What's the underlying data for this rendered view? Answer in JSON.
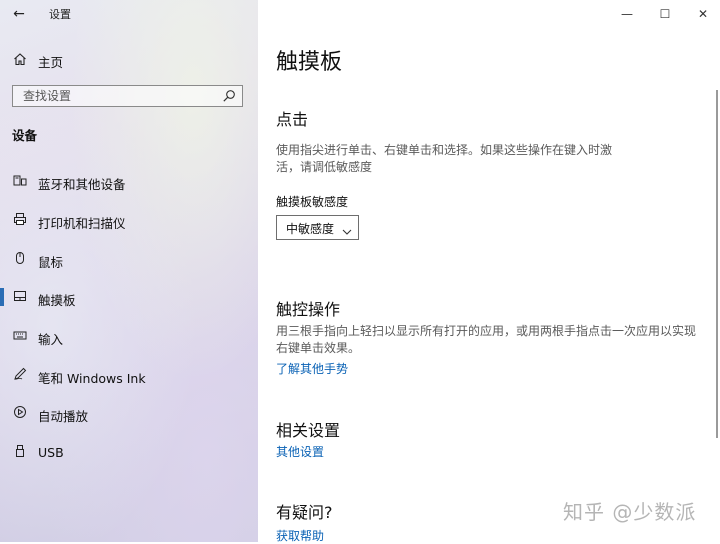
{
  "window": {
    "title": "设置",
    "back_glyph": "←",
    "minimize_glyph": "—",
    "maximize_glyph": "☐",
    "close_glyph": "✕"
  },
  "sidebar": {
    "home_label": "主页",
    "search_placeholder": "查找设置",
    "section_title": "设备",
    "items": [
      {
        "label": "蓝牙和其他设备",
        "icon": "bluetooth-devices-icon"
      },
      {
        "label": "打印机和扫描仪",
        "icon": "printer-icon"
      },
      {
        "label": "鼠标",
        "icon": "mouse-icon"
      },
      {
        "label": "触摸板",
        "icon": "touchpad-icon",
        "active": true
      },
      {
        "label": "输入",
        "icon": "keyboard-icon"
      },
      {
        "label": "笔和 Windows Ink",
        "icon": "pen-icon"
      },
      {
        "label": "自动播放",
        "icon": "autoplay-icon"
      },
      {
        "label": "USB",
        "icon": "usb-icon"
      }
    ]
  },
  "main": {
    "page_title": "触摸板",
    "tap": {
      "heading": "点击",
      "description_line1": "使用指尖进行单击、右键单击和选择。如果这些操作在键入时激",
      "description_line2": "活，请调低敏感度",
      "sensitivity_label": "触摸板敏感度",
      "sensitivity_value": "中敏感度"
    },
    "gestures": {
      "heading": "触控操作",
      "description_line1": "用三根手指向上轻扫以显示所有打开的应用，或用两根手指点击一次应用以实现",
      "description_line2": "右键单击效果。",
      "link": "了解其他手势"
    },
    "related": {
      "heading": "相关设置",
      "link": "其他设置"
    },
    "help": {
      "heading": "有疑问?",
      "link": "获取帮助"
    }
  },
  "watermark": "知乎 @少数派",
  "colors": {
    "accent": "#2a6db5",
    "link": "#0a62b5"
  }
}
